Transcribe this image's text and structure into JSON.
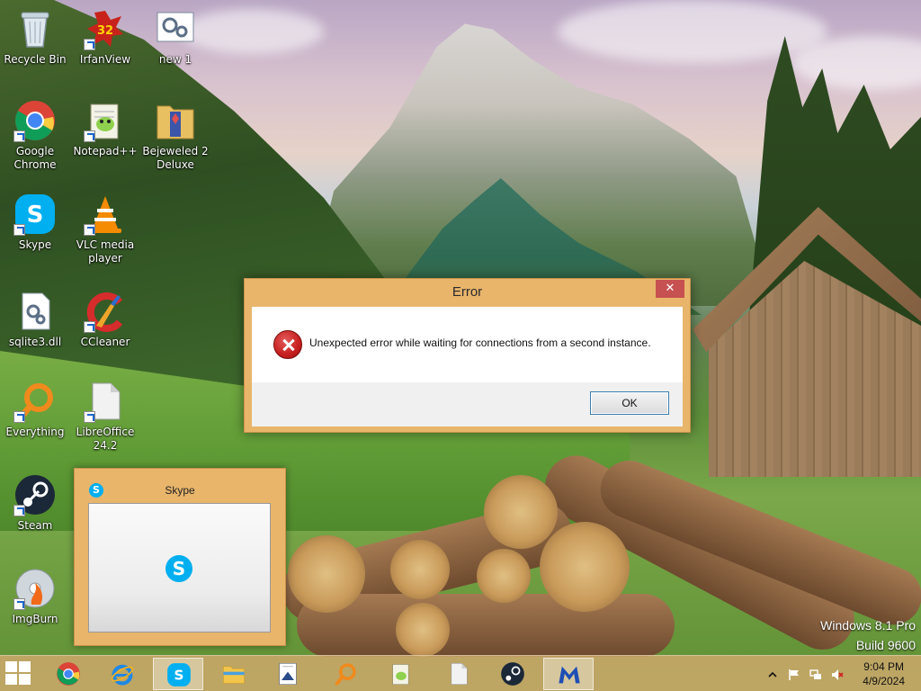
{
  "desktop": {
    "icons": [
      {
        "label": "Recycle Bin",
        "icon": "recycle-bin-icon"
      },
      {
        "label": "IrfanView",
        "icon": "irfanview-icon",
        "badge": "32"
      },
      {
        "label": "new 1",
        "icon": "file-gear-icon"
      },
      {
        "label": "Google Chrome",
        "icon": "chrome-icon"
      },
      {
        "label": "Notepad++",
        "icon": "notepadplusplus-icon"
      },
      {
        "label": "Bejeweled 2 Deluxe",
        "icon": "bejeweled-folder-icon"
      },
      {
        "label": "Skype",
        "icon": "skype-icon"
      },
      {
        "label": "VLC media player",
        "icon": "vlc-icon"
      },
      {
        "label": "sqlite3.dll",
        "icon": "dll-file-icon"
      },
      {
        "label": "CCleaner",
        "icon": "ccleaner-icon"
      },
      {
        "label": "Everything",
        "icon": "everything-search-icon"
      },
      {
        "label": "LibreOffice 24.2",
        "icon": "libreoffice-icon"
      },
      {
        "label": "Steam",
        "icon": "steam-icon"
      },
      {
        "label": "ImgBurn",
        "icon": "imgburn-icon"
      }
    ]
  },
  "dialog": {
    "title": "Error",
    "close_glyph": "✕",
    "message": "Unexpected error while waiting for connections from a second instance.",
    "ok_label": "OK"
  },
  "thumbnail": {
    "title": "Skype",
    "icon_glyph": "S"
  },
  "watermark": {
    "line1": "Windows 8.1 Pro",
    "line2": "Build 9600"
  },
  "taskbar": {
    "apps": [
      {
        "name": "Google Chrome",
        "icon": "chrome-icon",
        "active": false
      },
      {
        "name": "Internet Explorer",
        "icon": "internet-explorer-icon",
        "active": false
      },
      {
        "name": "Skype",
        "icon": "skype-icon",
        "active": true
      },
      {
        "name": "File Explorer",
        "icon": "file-explorer-icon",
        "active": false
      },
      {
        "name": "Document Viewer",
        "icon": "document-viewer-icon",
        "active": false
      },
      {
        "name": "Everything",
        "icon": "everything-search-icon",
        "active": false
      },
      {
        "name": "Notepad++",
        "icon": "notepadplusplus-icon",
        "active": false
      },
      {
        "name": "LibreOffice",
        "icon": "libreoffice-icon",
        "active": false
      },
      {
        "name": "Steam",
        "icon": "steam-icon",
        "active": false
      },
      {
        "name": "Malwarebytes",
        "icon": "malwarebytes-icon",
        "active": true
      }
    ],
    "clock": {
      "time": "9:04 PM",
      "date": "4/9/2024"
    }
  },
  "colors": {
    "window_frame": "#e8b56b",
    "close_button": "#c75050",
    "error_red": "#c71f1f",
    "skype_blue": "#00aff0"
  }
}
